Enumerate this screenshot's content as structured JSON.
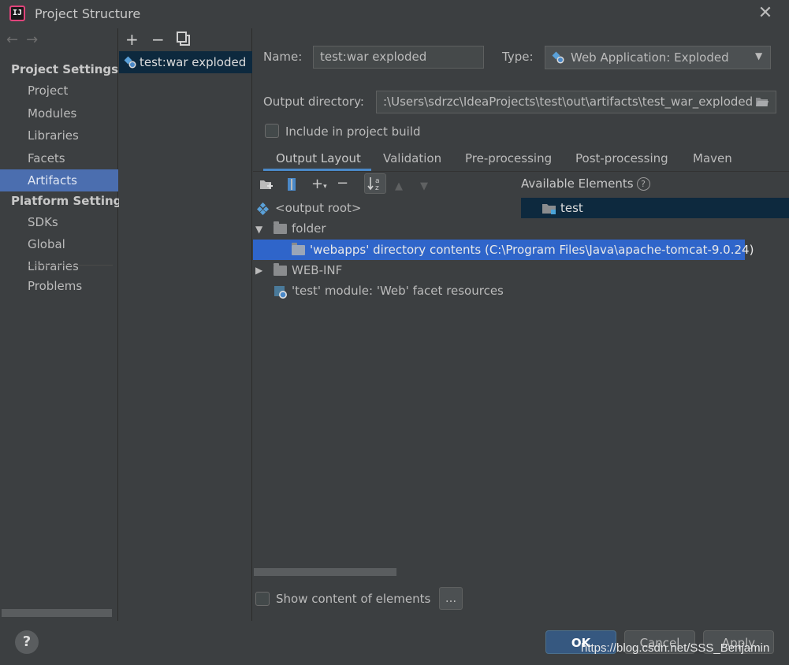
{
  "window": {
    "title": "Project Structure",
    "app_icon_text": "IJ"
  },
  "nav": {
    "back_icon": "arrow-left-icon",
    "forward_icon": "arrow-right-icon",
    "project_settings_header": "Project Settings",
    "project_items": [
      "Project",
      "Modules",
      "Libraries",
      "Facets",
      "Artifacts"
    ],
    "platform_settings_header": "Platform Settings",
    "platform_items": [
      "SDKs",
      "Global Libraries"
    ],
    "problems": "Problems",
    "selected": "Artifacts"
  },
  "artifacts_list": {
    "add_label": "+",
    "remove_label": "−",
    "copy_icon": "copy-icon",
    "items": [
      "test:war exploded"
    ]
  },
  "artifact": {
    "name_label": "Name:",
    "name_value": "test:war exploded",
    "type_label": "Type:",
    "type_value": "Web Application: Exploded",
    "output_dir_label": "Output directory:",
    "output_dir_value": ":\\Users\\sdrzc\\IdeaProjects\\test\\out\\artifacts\\test_war_exploded",
    "include_in_build_label": "Include in project build",
    "include_in_build_checked": false
  },
  "tabs": [
    "Output Layout",
    "Validation",
    "Pre-processing",
    "Post-processing",
    "Maven"
  ],
  "active_tab": "Output Layout",
  "layout_tree": {
    "output_root": "<output root>",
    "folder": "folder",
    "webapps_entry": "'webapps' directory contents (C:\\Program Files\\Java\\apache-tomcat-9.0.24)",
    "web_inf": "WEB-INF",
    "facet_resources": "'test' module: 'Web' facet resources"
  },
  "available_elements": {
    "header": "Available Elements",
    "help": "?",
    "items": [
      "test"
    ]
  },
  "show_content_label": "Show content of elements",
  "ellipsis_button": "...",
  "buttons": {
    "help": "?",
    "ok": "OK",
    "cancel": "Cancel",
    "apply": "Apply"
  },
  "watermark": "https://blog.csdn.net/SSS_Benjamin",
  "colors": {
    "background": "#3c3f41",
    "selection": "#4b6eaf",
    "tree_selection": "#2f65ca",
    "accent_tab": "#4a88c7"
  }
}
